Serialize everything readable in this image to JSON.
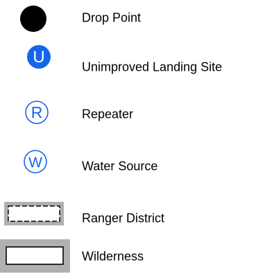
{
  "legend": {
    "items": [
      {
        "label": "Drop Point",
        "icon": "drop-point-icon"
      },
      {
        "label": "Unimproved Landing Site",
        "icon": "unimproved-landing-site-icon",
        "symbol_text": "U"
      },
      {
        "label": "Repeater",
        "icon": "repeater-icon",
        "symbol_text": "R"
      },
      {
        "label": "Water Source",
        "icon": "water-source-icon",
        "symbol_text": "W"
      },
      {
        "label": "Ranger District",
        "icon": "ranger-district-icon"
      },
      {
        "label": "Wilderness",
        "icon": "wilderness-icon"
      }
    ],
    "colors": {
      "drop_point": "#000000",
      "blue": "#1565e8",
      "boundary_gray": "#b0b0b0",
      "boundary_line": "#000000"
    }
  }
}
